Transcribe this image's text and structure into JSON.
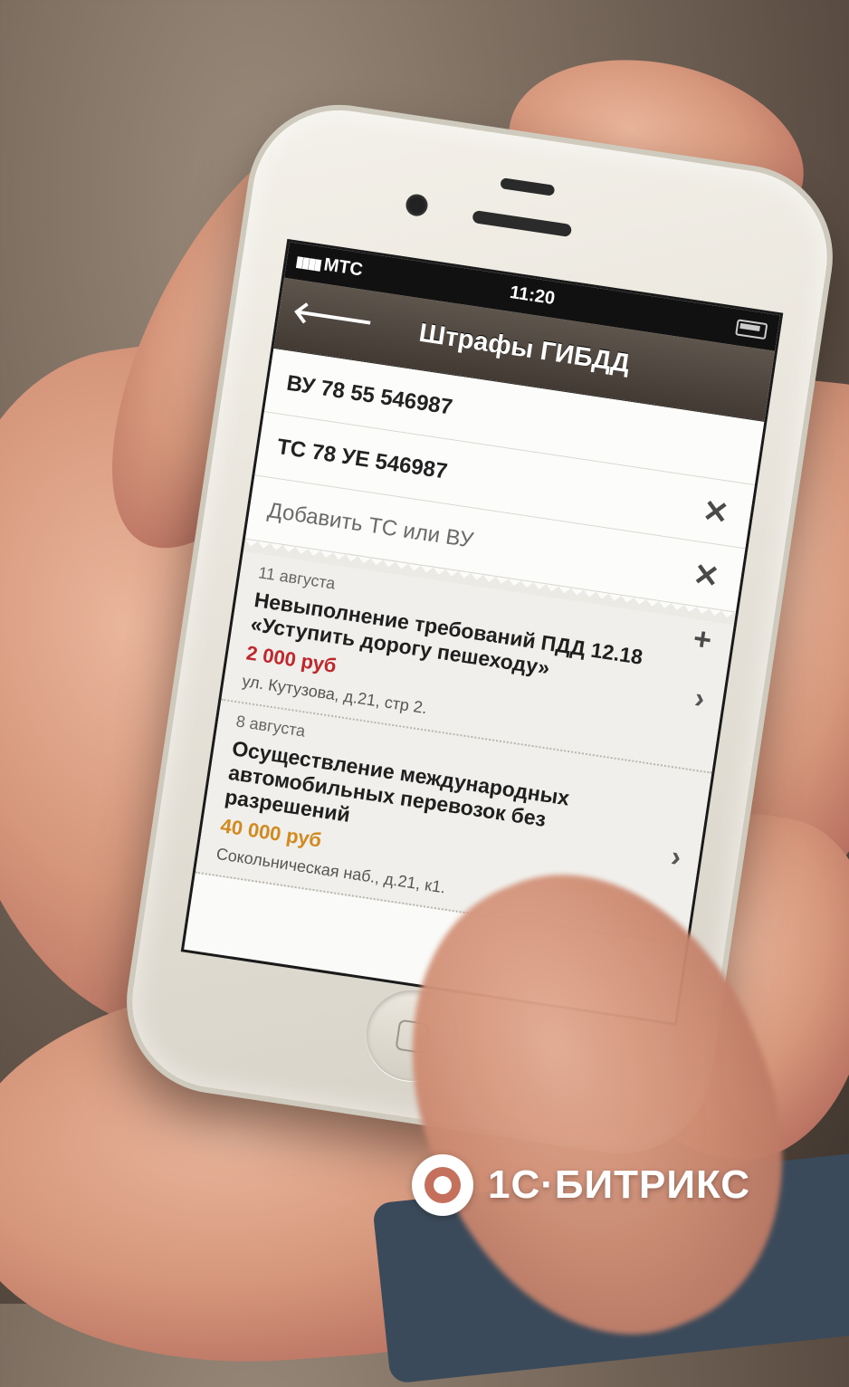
{
  "status_bar": {
    "carrier": "МТС",
    "signal_icon": "signal-bars-icon",
    "time": "11:20",
    "battery_icon": "battery-icon"
  },
  "nav_bar": {
    "back_icon": "back-arrow-icon",
    "back_glyph": "🡐",
    "title": "Штрафы ГИБДД"
  },
  "documents": [
    {
      "label": "ВУ 78 55 546987",
      "icon": "",
      "icon_name": ""
    },
    {
      "label": "ТС 78 УЕ 546987",
      "icon": "✕",
      "icon_name": "remove-icon"
    }
  ],
  "add_row": {
    "label": "Добавить ТС или ВУ",
    "icon": "✕",
    "icon_name": "remove-icon",
    "plus": "+"
  },
  "fines": [
    {
      "date": "11 августа",
      "title": "Невыполнение требований ПДД 12.18 «Уступить дорогу пешеходу»",
      "amount": "2 000 руб",
      "amount_color": "#c0272d",
      "address": "ул. Кутузова, д.21, стр 2."
    },
    {
      "date": "8 августа",
      "title": "Осуществление международных автомобильных перевозок без разрешений",
      "amount": "40 000 руб",
      "amount_color": "#d18a1f",
      "address": "Сокольническая наб., д.21, к1."
    }
  ],
  "chevron": "›",
  "logo_text": "1С·БИТРИКС"
}
